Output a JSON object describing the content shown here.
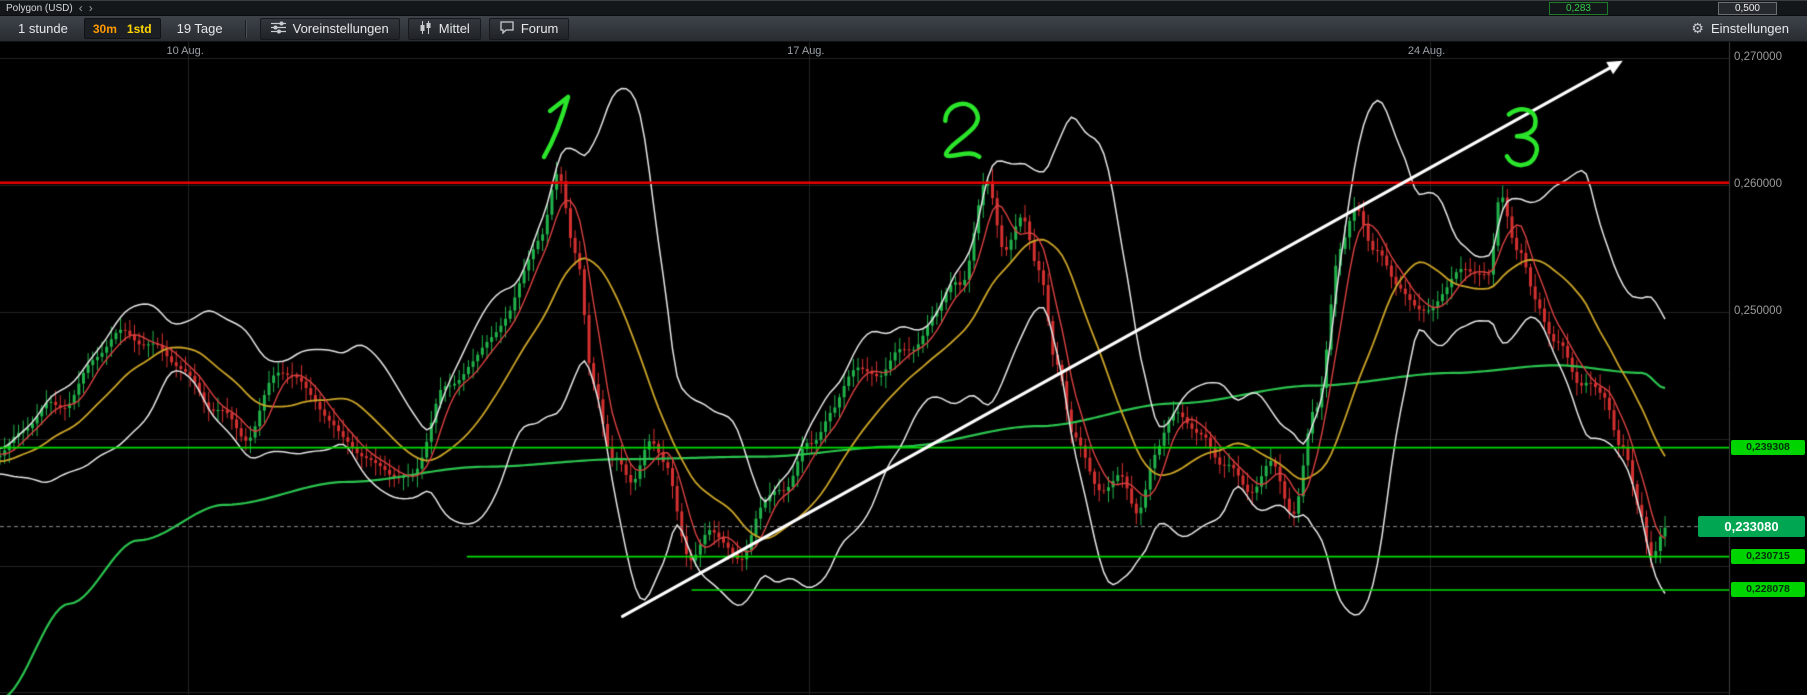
{
  "window": {
    "title": "Polygon (USD)",
    "sell_price": "0,283",
    "buy_price": "0,500"
  },
  "toolbar": {
    "timeframe_label": "1 stunde",
    "tf_30m": "30m",
    "tf_1std": "1std",
    "range_label": "19 Tage",
    "presets_label": "Voreinstellungen",
    "indicators_label": "Mittel",
    "forum_label": "Forum",
    "settings_label": "Einstellungen"
  },
  "chart_data": {
    "type": "candlestick",
    "symbol": "Polygon (USD)",
    "interval": "1std",
    "visible_range": "19 Tage",
    "price_min": 0.2198,
    "price_max": 0.2713,
    "x_ticks": [
      {
        "label": "10 Aug.",
        "frac": 0.109
      },
      {
        "label": "17 Aug.",
        "frac": 0.468
      },
      {
        "label": "24 Aug.",
        "frac": 0.827
      }
    ],
    "y_ticks": [
      {
        "label": "0,270000",
        "price": 0.27
      },
      {
        "label": "0,260000",
        "price": 0.26
      },
      {
        "label": "0,250000",
        "price": 0.25
      }
    ],
    "grid_prices": [
      0.27,
      0.26,
      0.25,
      0.24,
      0.23,
      0.22
    ],
    "close_anchors": [
      [
        0.0,
        0.238
      ],
      [
        0.03,
        0.2425
      ],
      [
        0.067,
        0.2478
      ],
      [
        0.1,
        0.2465
      ],
      [
        0.123,
        0.2435
      ],
      [
        0.143,
        0.2405
      ],
      [
        0.163,
        0.2455
      ],
      [
        0.18,
        0.244
      ],
      [
        0.2,
        0.2408
      ],
      [
        0.22,
        0.2378
      ],
      [
        0.237,
        0.2362
      ],
      [
        0.257,
        0.2438
      ],
      [
        0.273,
        0.2465
      ],
      [
        0.293,
        0.2495
      ],
      [
        0.313,
        0.2552
      ],
      [
        0.323,
        0.2598
      ],
      [
        0.333,
        0.2545
      ],
      [
        0.343,
        0.244
      ],
      [
        0.355,
        0.2388
      ],
      [
        0.365,
        0.2362
      ],
      [
        0.375,
        0.2395
      ],
      [
        0.385,
        0.2368
      ],
      [
        0.4,
        0.2295
      ],
      [
        0.412,
        0.233
      ],
      [
        0.427,
        0.2307
      ],
      [
        0.44,
        0.235
      ],
      [
        0.453,
        0.2362
      ],
      [
        0.468,
        0.239
      ],
      [
        0.481,
        0.2422
      ],
      [
        0.497,
        0.2468
      ],
      [
        0.508,
        0.2455
      ],
      [
        0.519,
        0.2482
      ],
      [
        0.528,
        0.247
      ],
      [
        0.541,
        0.2502
      ],
      [
        0.555,
        0.2522
      ],
      [
        0.571,
        0.2605
      ],
      [
        0.581,
        0.256
      ],
      [
        0.591,
        0.2578
      ],
      [
        0.601,
        0.254
      ],
      [
        0.611,
        0.2452
      ],
      [
        0.621,
        0.24
      ],
      [
        0.635,
        0.2352
      ],
      [
        0.647,
        0.2372
      ],
      [
        0.657,
        0.2342
      ],
      [
        0.668,
        0.239
      ],
      [
        0.681,
        0.242
      ],
      [
        0.695,
        0.239
      ],
      [
        0.708,
        0.2372
      ],
      [
        0.721,
        0.2355
      ],
      [
        0.735,
        0.238
      ],
      [
        0.748,
        0.2346
      ],
      [
        0.761,
        0.242
      ],
      [
        0.775,
        0.254
      ],
      [
        0.785,
        0.2578
      ],
      [
        0.795,
        0.2545
      ],
      [
        0.808,
        0.253
      ],
      [
        0.821,
        0.2506
      ],
      [
        0.835,
        0.252
      ],
      [
        0.848,
        0.2536
      ],
      [
        0.861,
        0.2524
      ],
      [
        0.868,
        0.2596
      ],
      [
        0.878,
        0.2552
      ],
      [
        0.888,
        0.252
      ],
      [
        0.901,
        0.2482
      ],
      [
        0.915,
        0.245
      ],
      [
        0.928,
        0.243
      ],
      [
        0.938,
        0.2392
      ],
      [
        0.948,
        0.2342
      ],
      [
        0.955,
        0.2312
      ],
      [
        0.963,
        0.2331
      ]
    ],
    "slow_ma_anchors": [
      [
        0.0,
        0.2195
      ],
      [
        0.04,
        0.227
      ],
      [
        0.08,
        0.232
      ],
      [
        0.13,
        0.2348
      ],
      [
        0.2,
        0.2366
      ],
      [
        0.28,
        0.2378
      ],
      [
        0.36,
        0.2384
      ],
      [
        0.44,
        0.2386
      ],
      [
        0.52,
        0.2394
      ],
      [
        0.6,
        0.241
      ],
      [
        0.68,
        0.2428
      ],
      [
        0.76,
        0.2442
      ],
      [
        0.84,
        0.2452
      ],
      [
        0.9,
        0.2458
      ],
      [
        0.95,
        0.2452
      ],
      [
        0.963,
        0.244
      ]
    ],
    "levels": {
      "resistance": {
        "price": 0.2602,
        "color": "#e80000"
      },
      "support_lines": [
        {
          "price": 0.239308,
          "label": "0,239308",
          "start_frac": 0.0
        },
        {
          "price": 0.230715,
          "label": "0,230715",
          "start_frac": 0.27
        },
        {
          "price": 0.228078,
          "label": "0,228078",
          "start_frac": 0.4
        }
      ],
      "current_price": {
        "price": 0.23308,
        "label": "0,233080"
      }
    },
    "trend_line": {
      "from": {
        "frac": 0.36,
        "price": 0.226
      },
      "to": {
        "frac": 0.933,
        "price": 0.2694
      }
    },
    "annotations": [
      {
        "text": "1",
        "frac": 0.3216,
        "price": 0.2646
      },
      {
        "text": "2",
        "frac": 0.556,
        "price": 0.2643
      },
      {
        "text": "3",
        "frac": 0.8808,
        "price": 0.2637
      }
    ],
    "colors": {
      "up": "#21b24b",
      "down": "#d43030",
      "band": "#e4e4e4",
      "ma_fast": "#d84040",
      "ma_mid": "#c9a227",
      "ma_slow": "#2bc24e",
      "support": "#00dc00",
      "support_badge": "#00d400",
      "current_badge": "#00a651",
      "current_line": "#8a8a8a",
      "annotation": "#2be52b",
      "trend": "#ffffff",
      "grid": "#232323"
    }
  }
}
